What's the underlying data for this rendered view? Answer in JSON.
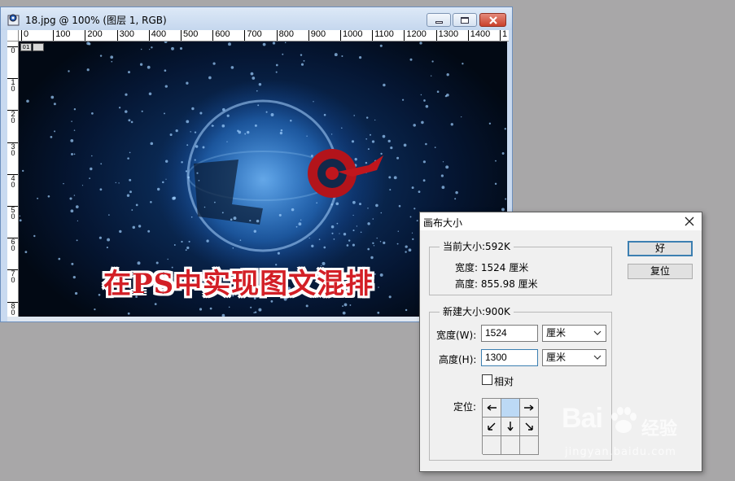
{
  "document_window": {
    "title": "18.jpg @ 100% (图层 1, RGB)",
    "ruler_h_ticks": [
      "0",
      "100",
      "200",
      "300",
      "400",
      "500",
      "600",
      "700",
      "800",
      "900",
      "1000",
      "1100",
      "1200",
      "1300",
      "1400",
      "1"
    ],
    "ruler_v_ticks": [
      "0",
      "1\n0",
      "2\n0",
      "3\n0",
      "4\n0",
      "5\n0",
      "6\n0",
      "7\n0",
      "8\n0"
    ],
    "canvas_chip": "01",
    "banner_text": "在PS中实现图文混排"
  },
  "dialog": {
    "title": "画布大小",
    "current_size": {
      "legend": "当前大小:592K",
      "width_line": "宽度: 1524 厘米",
      "height_line": "高度: 855.98 厘米"
    },
    "new_size": {
      "legend": "新建大小:900K",
      "width_label": "宽度(W):",
      "width_value": "1524",
      "width_unit": "厘米",
      "height_label": "高度(H):",
      "height_value": "1300",
      "height_unit": "厘米",
      "relative_label": "相对",
      "relative_checked": false,
      "anchor_label": "定位:"
    },
    "ok_label": "好",
    "reset_label": "复位"
  },
  "watermark": {
    "brand": "Bai",
    "brand_suffix": "经验",
    "url": "jingyan.baidu.com"
  },
  "colors": {
    "banner_red": "#d31f26",
    "focus_blue": "#3c7fb1",
    "anchor_active": "#bcd9f5"
  }
}
